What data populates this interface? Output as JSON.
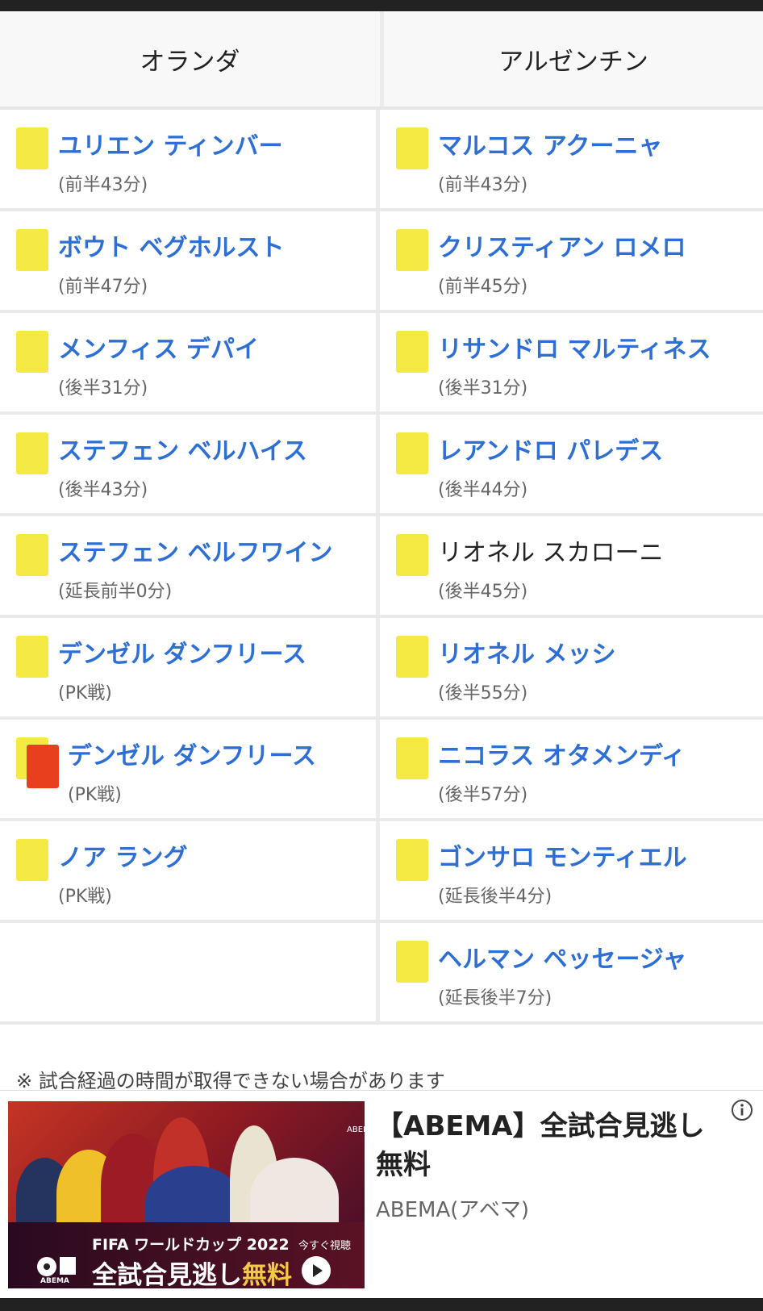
{
  "teams": {
    "left": "オランダ",
    "right": "アルゼンチン"
  },
  "rows": [
    {
      "left": {
        "name": "ユリエン ティンバー",
        "time": "(前半43分)"
      },
      "right": {
        "name": "マルコス アクーニャ",
        "time": "(前半43分)"
      }
    },
    {
      "left": {
        "name": "ボウト ベグホルスト",
        "time": "(前半47分)"
      },
      "right": {
        "name": "クリスティアン ロメロ",
        "time": "(前半45分)"
      }
    },
    {
      "left": {
        "name": "メンフィス デパイ",
        "time": "(後半31分)"
      },
      "right": {
        "name": "リサンドロ マルティネス",
        "time": "(後半31分)"
      }
    },
    {
      "left": {
        "name": "ステフェン ベルハイス",
        "time": "(後半43分)"
      },
      "right": {
        "name": "レアンドロ パレデス",
        "time": "(後半44分)"
      }
    },
    {
      "left": {
        "name": "ステフェン ベルフワイン",
        "time": "(延長前半0分)"
      },
      "right": {
        "name": "リオネル スカローニ",
        "time": "(後半45分)"
      }
    },
    {
      "left": {
        "name": "デンゼル ダンフリース",
        "time": "(PK戦)"
      },
      "right": {
        "name": "リオネル メッシ",
        "time": "(後半55分)"
      }
    },
    {
      "left": {
        "name": "デンゼル ダンフリース",
        "time": "(PK戦)"
      },
      "right": {
        "name": "ニコラス オタメンディ",
        "time": "(後半57分)"
      }
    },
    {
      "left": {
        "name": "ノア ラング",
        "time": "(PK戦)"
      },
      "right": {
        "name": "ゴンサロ モンティエル",
        "time": "(延長後半4分)"
      }
    },
    {
      "left": null,
      "right": {
        "name": "ヘルマン ペッセージャ",
        "time": "(延長後半7分)"
      }
    }
  ],
  "card_colors": {
    "yellow": "#f5e943",
    "red": "#e8401e"
  },
  "note": "※ 試合経過の時間が取得できない場合があります",
  "ad": {
    "title": "【ABEMA】全試合見逃し無料",
    "source": "ABEMA(アベマ)",
    "image": {
      "line1": "FIFA ワールドカップ 2022",
      "line2_prefix": "全試合見逃し",
      "line2_highlight": "無料",
      "cta": "今すぐ視聴",
      "brand": "ABEMA"
    },
    "info_icon": "info-icon"
  }
}
